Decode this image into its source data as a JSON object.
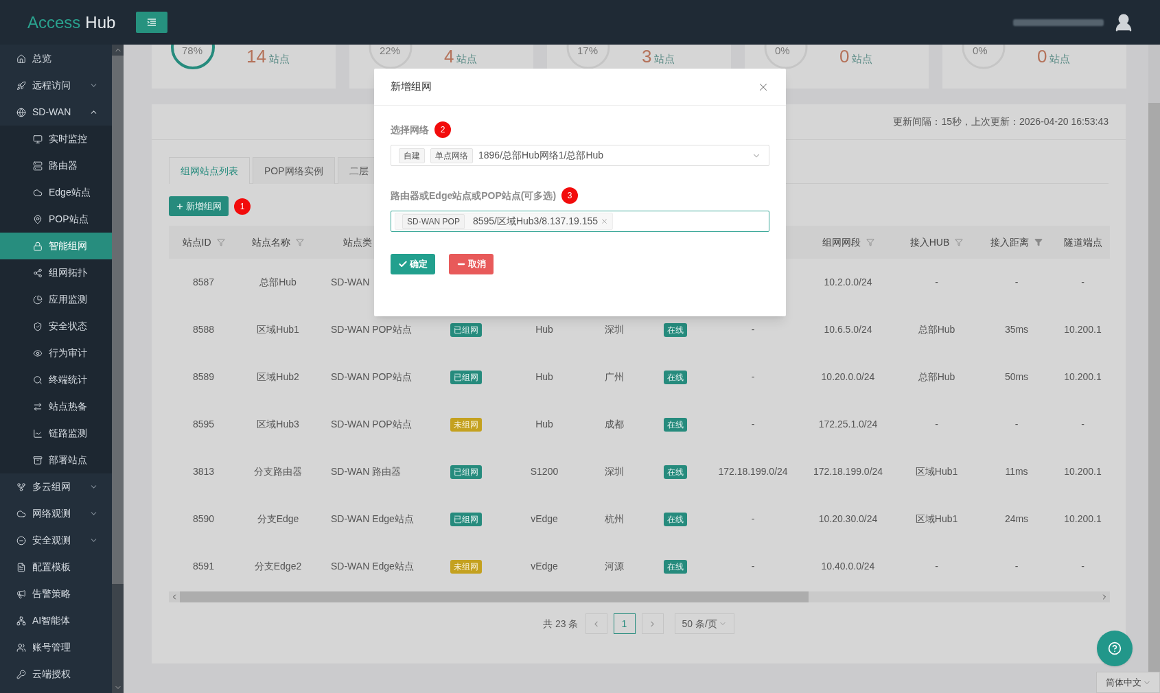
{
  "header": {
    "logo": {
      "accent": "Access",
      "rest": "Hub"
    }
  },
  "sidebar": {
    "items": [
      {
        "kind": "link",
        "label": "总览",
        "selected": false
      },
      {
        "kind": "group",
        "label": "远程访问",
        "selected": false,
        "expanded": false
      },
      {
        "kind": "group",
        "label": "SD-WAN",
        "selected": false,
        "expanded": true,
        "children": [
          {
            "label": "实时监控",
            "selected": false
          },
          {
            "label": "路由器",
            "selected": false
          },
          {
            "label": "Edge站点",
            "selected": false
          },
          {
            "label": "POP站点",
            "selected": false
          },
          {
            "label": "智能组网",
            "selected": true
          },
          {
            "label": "组网拓扑",
            "selected": false
          },
          {
            "label": "应用监测",
            "selected": false
          },
          {
            "label": "安全状态",
            "selected": false
          },
          {
            "label": "行为审计",
            "selected": false
          },
          {
            "label": "终端统计",
            "selected": false
          },
          {
            "label": "站点热备",
            "selected": false
          },
          {
            "label": "链路监测",
            "selected": false
          },
          {
            "label": "部署站点",
            "selected": false
          }
        ]
      },
      {
        "kind": "group",
        "label": "多云组网",
        "selected": false,
        "expanded": false
      },
      {
        "kind": "group",
        "label": "网络观测",
        "selected": false,
        "expanded": false
      },
      {
        "kind": "group",
        "label": "安全观测",
        "selected": false,
        "expanded": false
      },
      {
        "kind": "link",
        "label": "配置模板",
        "selected": false
      },
      {
        "kind": "link",
        "label": "告警策略",
        "selected": false
      },
      {
        "kind": "link",
        "label": "AI智能体",
        "selected": false
      },
      {
        "kind": "link",
        "label": "账号管理",
        "selected": false
      },
      {
        "kind": "link",
        "label": "云端授权",
        "selected": false
      }
    ]
  },
  "stats": [
    {
      "percent": "78%",
      "count": "14",
      "unit": "站点"
    },
    {
      "percent": "22%",
      "count": "4",
      "unit": "站点"
    },
    {
      "percent": "17%",
      "count": "3",
      "unit": "站点"
    },
    {
      "percent": "0%",
      "count": "0",
      "unit": "站点"
    },
    {
      "percent": "0%",
      "count": "0",
      "unit": "站点"
    }
  ],
  "panel": {
    "update_info": "更新间隔：15秒，上次更新：2026-04-20 16:53:43",
    "tabs": [
      {
        "label": "组网站点列表",
        "selected": true
      },
      {
        "label": "POP网络实例",
        "selected": false
      },
      {
        "label": "二层",
        "selected": false
      }
    ],
    "add_button": {
      "label": "新增组网",
      "step": "1"
    },
    "table": {
      "columns": {
        "id": {
          "label": "站点ID",
          "filtered": false
        },
        "name": {
          "label": "站点名称",
          "filtered": false
        },
        "type": {
          "label": "站点类"
        },
        "segment": {
          "label": "组网网段",
          "filtered": false
        },
        "hub": {
          "label": "接入HUB",
          "filtered": false
        },
        "distance": {
          "label": "接入距离",
          "filtered": true
        },
        "tunnel": {
          "label": "隧道端点"
        }
      },
      "rows": [
        {
          "id": "8587",
          "name": "总部Hub",
          "type": "SD-WAN",
          "segment": "10.2.0.0/24",
          "hub": "-",
          "distance": "-",
          "tunnel": "-"
        },
        {
          "id": "8588",
          "name": "区域Hub1",
          "type": "SD-WAN POP站点",
          "status": {
            "text": "已组网",
            "kind": "joined"
          },
          "model": "Hub",
          "city": "深圳",
          "online": {
            "text": "在线",
            "kind": "online"
          },
          "lan": "-",
          "segment": "10.6.5.0/24",
          "hub": "总部Hub",
          "distance": "35ms",
          "tunnel": "10.200.1"
        },
        {
          "id": "8589",
          "name": "区域Hub2",
          "type": "SD-WAN POP站点",
          "status": {
            "text": "已组网",
            "kind": "joined"
          },
          "model": "Hub",
          "city": "广州",
          "online": {
            "text": "在线",
            "kind": "online"
          },
          "lan": "-",
          "segment": "10.20.0.0/24",
          "hub": "总部Hub",
          "distance": "50ms",
          "tunnel": "10.200.1"
        },
        {
          "id": "8595",
          "name": "区域Hub3",
          "type": "SD-WAN POP站点",
          "status": {
            "text": "未组网",
            "kind": "pending"
          },
          "model": "Hub",
          "city": "成都",
          "online": {
            "text": "在线",
            "kind": "online"
          },
          "lan": "-",
          "segment": "172.25.1.0/24",
          "hub": "-",
          "distance": "-",
          "tunnel": "-"
        },
        {
          "id": "3813",
          "name": "分支路由器",
          "type": "SD-WAN 路由器",
          "status": {
            "text": "已组网",
            "kind": "joined"
          },
          "model": "S1200",
          "city": "深圳",
          "online": {
            "text": "在线",
            "kind": "online"
          },
          "lan": "172.18.199.0/24",
          "segment": "172.18.199.0/24",
          "hub": "区域Hub1",
          "distance": "11ms",
          "tunnel": "10.200.1"
        },
        {
          "id": "8590",
          "name": "分支Edge",
          "type": "SD-WAN Edge站点",
          "status": {
            "text": "已组网",
            "kind": "joined"
          },
          "model": "vEdge",
          "city": "杭州",
          "online": {
            "text": "在线",
            "kind": "online"
          },
          "lan": "-",
          "segment": "10.20.30.0/24",
          "hub": "区域Hub1",
          "distance": "24ms",
          "tunnel": "10.200.1"
        },
        {
          "id": "8591",
          "name": "分支Edge2",
          "type": "SD-WAN Edge站点",
          "status": {
            "text": "未组网",
            "kind": "pending"
          },
          "model": "vEdge",
          "city": "河源",
          "online": {
            "text": "在线",
            "kind": "online"
          },
          "lan": "-",
          "segment": "10.40.0.0/24",
          "hub": "-",
          "distance": "-",
          "tunnel": "-"
        }
      ]
    },
    "pagination": {
      "total": "共 23 条",
      "pages": [
        {
          "label": "1",
          "selected": true
        }
      ],
      "page_size": "50 条/页"
    }
  },
  "language": "简体中文",
  "modal": {
    "title": "新增组网",
    "fields": [
      {
        "kind": "select",
        "label": "选择网络",
        "step": "2",
        "tags": [
          "自建",
          "单点网络"
        ],
        "value": "1896/总部Hub网络1/总部Hub",
        "focused": false
      },
      {
        "kind": "multiselect",
        "label": "路由器或Edge站点或POP站点(可多选)",
        "step": "3",
        "chips": [
          {
            "tag": "SD-WAN POP",
            "value": "8595/区域Hub3/8.137.19.155"
          }
        ],
        "focused": true
      }
    ],
    "buttons": [
      {
        "label": "确定",
        "kind": "confirm"
      },
      {
        "label": "取消",
        "kind": "cancel"
      }
    ]
  }
}
